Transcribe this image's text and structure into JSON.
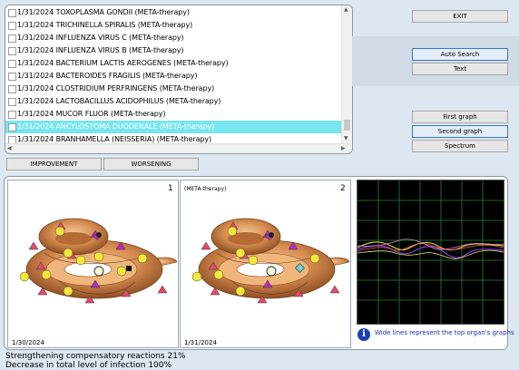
{
  "list": {
    "items": [
      {
        "label": "1/31/2024  TOXOPLASMA GONDII (META-therapy)",
        "selected": false
      },
      {
        "label": "1/31/2024  TRICHINELLA SPIRALIS (META-therapy)",
        "selected": false
      },
      {
        "label": "1/31/2024  INFLUENZA VIRUS C (META-therapy)",
        "selected": false
      },
      {
        "label": "1/31/2024  INFLUENZA VIRUS B (META-therapy)",
        "selected": false
      },
      {
        "label": "1/31/2024  BACTERIUM LACTIS AEROGENES (META-therapy)",
        "selected": false
      },
      {
        "label": "1/31/2024  BACTEROIDES FRAGILIS (META-therapy)",
        "selected": false
      },
      {
        "label": "1/31/2024  CLOSTRIDIUM PERFRINGENS (META-therapy)",
        "selected": false
      },
      {
        "label": "1/31/2024  LACTOBACILLUS ACIDOPHILUS (META-therapy)",
        "selected": false
      },
      {
        "label": "1/31/2024  MUCOR FLUOR (META-therapy)",
        "selected": false
      },
      {
        "label": "1/31/2024  ANCYLOSTOMA DUODENALE (META-therapy)",
        "selected": true
      },
      {
        "label": "1/31/2024  BRANHAMELLA (NEISSERIA) (META-therapy)",
        "selected": false
      }
    ],
    "selected_color": "#78e6ee"
  },
  "buttons": {
    "exit": "EXIT",
    "auto_search": "Auto Search",
    "text": "Text",
    "first_graph": "First graph",
    "second_graph": "Second graph",
    "spectrum": "Spectrum",
    "improvement": "IMPROVEMENT",
    "worsening": "WORSENING"
  },
  "graphs": {
    "left": {
      "number": "1",
      "date": "1/30/2024",
      "label": ""
    },
    "right": {
      "number": "2",
      "date": "1/31/2024",
      "label": "(META-therapy)"
    }
  },
  "info": {
    "text": "Wide lines represent the top organ's graphs"
  },
  "status": {
    "line1": "Strengthening compensatory reactions 21%",
    "line2": "Decrease in total level of infection 100%"
  },
  "colors": {
    "background": "#dde7f1",
    "highlight_border": "#3b78c4",
    "info_text": "#1a2fb0",
    "oscilloscope_bg": "#000000",
    "oscilloscope_grid": "#1f8a1f"
  }
}
